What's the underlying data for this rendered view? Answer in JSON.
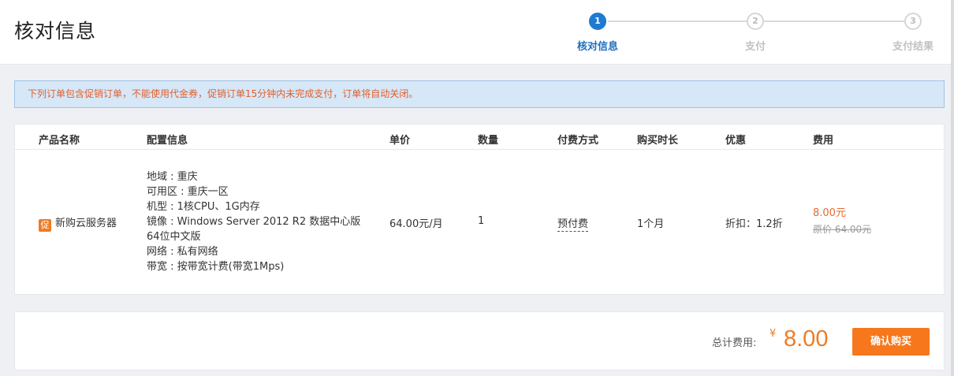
{
  "header": {
    "title": "核对信息",
    "steps": [
      {
        "num": "1",
        "label": "核对信息",
        "state": "active"
      },
      {
        "num": "2",
        "label": "支付",
        "state": "todo"
      },
      {
        "num": "3",
        "label": "支付结果",
        "state": "todo"
      }
    ]
  },
  "notice": "下列订单包含促销订单，不能使用代金券，促销订单15分钟内未完成支付，订单将自动关闭。",
  "table": {
    "columns": [
      "产品名称",
      "配置信息",
      "单价",
      "数量",
      "付费方式",
      "购买时长",
      "优惠",
      "费用"
    ],
    "row": {
      "badge": "促",
      "product": "新购云服务器",
      "config": [
        "地域 : 重庆",
        "可用区 : 重庆一区",
        "机型 : 1核CPU、1G内存",
        "镜像 : Windows Server 2012 R2 数据中心版",
        "64位中文版",
        "网络 : 私有网络",
        "带宽 : 按带宽计费(带宽1Mps)"
      ],
      "unit_price": "64.00元/月",
      "quantity": "1",
      "pay_type": "预付费",
      "duration": "1个月",
      "discount": "折扣：1.2折",
      "fee": "8.00元",
      "original_price": "原价 64.00元"
    }
  },
  "footer": {
    "total_label": "总计费用:",
    "currency": "¥",
    "total": "8.00",
    "confirm_label": "确认购买"
  },
  "colors": {
    "accent_blue": "#1f7ad0",
    "accent_orange": "#f6771c",
    "notice_bg": "#d6e7f7",
    "notice_text": "#e35e2a"
  }
}
